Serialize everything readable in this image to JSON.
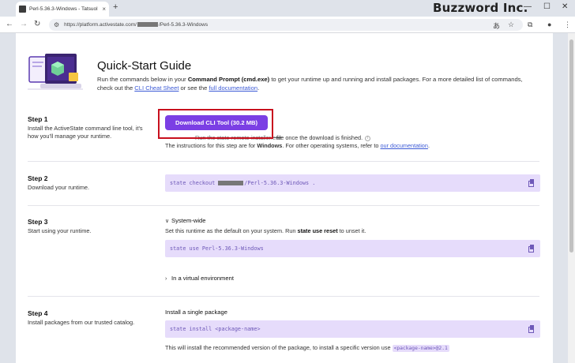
{
  "browser": {
    "tab_title": "Perl-5.36.3-Windows - Tatsuol",
    "tab_close": "×",
    "new_tab": "+",
    "brand": "Buzzword Inc.",
    "min": "—",
    "max": "☐",
    "close": "✕",
    "back": "←",
    "forward": "→",
    "reload": "↻",
    "url_prefix": "https://platform.activestate.com/",
    "url_suffix": "/Perl-5.36.3-Windows"
  },
  "guide": {
    "title": "Quick-Start Guide",
    "intro_1": "Run the commands below in your ",
    "intro_bold": "Command Prompt (cmd.exe)",
    "intro_2": " to get your runtime up and running and install packages. For a more detailed list of commands, check out the ",
    "intro_link1": "CLI Cheat Sheet",
    "intro_3": " or see the ",
    "intro_link2": "full documentation",
    "intro_4": "."
  },
  "steps": [
    {
      "title": "Step 1",
      "desc": "Install the ActiveState command line tool, it's how you'll manage your runtime."
    },
    {
      "title": "Step 2",
      "desc": "Download your runtime."
    },
    {
      "title": "Step 3",
      "desc": "Start using your runtime."
    },
    {
      "title": "Step 4",
      "desc": "Install packages from our trusted catalog."
    }
  ],
  "step1": {
    "button": "Download CLI Tool (30.2 MB)",
    "run_hidden": "Run the state-remote-installer.exe",
    "run_text": "file once the download is finished.",
    "info": "i",
    "instr_1": "The instructions for this step are for ",
    "instr_bold": "Windows",
    "instr_2": ". For other operating systems, refer to ",
    "instr_link": "our documentation",
    "instr_3": "."
  },
  "step2": {
    "code_prefix": "state checkout",
    "code_suffix": "/Perl-5.36.3-Windows ."
  },
  "step3": {
    "systemwide_chev": "∨",
    "systemwide": "System-wide",
    "desc_1": "Set this runtime as the default on your system. Run ",
    "desc_bold": "state use reset",
    "desc_2": " to unset it.",
    "code": "state use Perl-5.36.3-Windows",
    "venv_chev": "›",
    "venv": "In a virtual environment"
  },
  "step4": {
    "subhead": "Install a single package",
    "code": "state install <package-name>",
    "desc_1": "This will install the recommended version of the package, to install a specific version use ",
    "desc_code": "<package-name>@2.1"
  }
}
